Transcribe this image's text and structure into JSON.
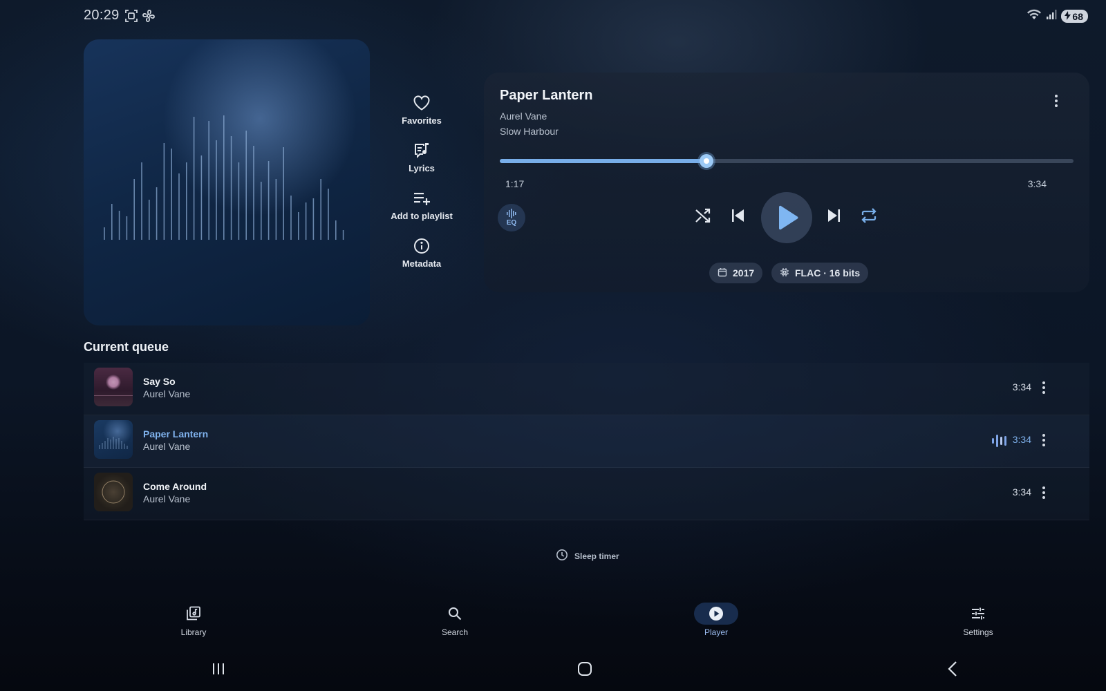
{
  "status_bar": {
    "time": "20:29",
    "battery_level": "68"
  },
  "side_actions": [
    {
      "label": "Favorites",
      "icon": "heart-icon"
    },
    {
      "label": "Lyrics",
      "icon": "lyrics-icon"
    },
    {
      "label": "Add to playlist",
      "icon": "playlist-add-icon"
    },
    {
      "label": "Metadata",
      "icon": "info-icon"
    }
  ],
  "now_playing": {
    "title": "Paper Lantern",
    "artist": "Aurel Vane",
    "album": "Slow Harbour",
    "elapsed": "1:17",
    "duration": "3:34",
    "progress": 0.36,
    "eq_label": "EQ",
    "year": "2017",
    "format": "FLAC · 16 bits"
  },
  "queue": {
    "heading": "Current queue",
    "items": [
      {
        "title": "Say So",
        "artist": "Aurel Vane",
        "duration": "3:34",
        "current": false
      },
      {
        "title": "Paper Lantern",
        "artist": "Aurel Vane",
        "duration": "3:34",
        "current": true
      },
      {
        "title": "Come Around",
        "artist": "Aurel Vane",
        "duration": "3:34",
        "current": false
      }
    ]
  },
  "sleep_timer_label": "Sleep timer",
  "bottom_nav": [
    {
      "label": "Library",
      "icon": "library-icon",
      "active": false
    },
    {
      "label": "Search",
      "icon": "search-icon",
      "active": false
    },
    {
      "label": "Player",
      "icon": "play-circle-icon",
      "active": true
    },
    {
      "label": "Settings",
      "icon": "sliders-icon",
      "active": false
    }
  ],
  "colors": {
    "accent": "#78aee9",
    "accent_text": "#7fb1ec",
    "background": "#0c1626"
  }
}
